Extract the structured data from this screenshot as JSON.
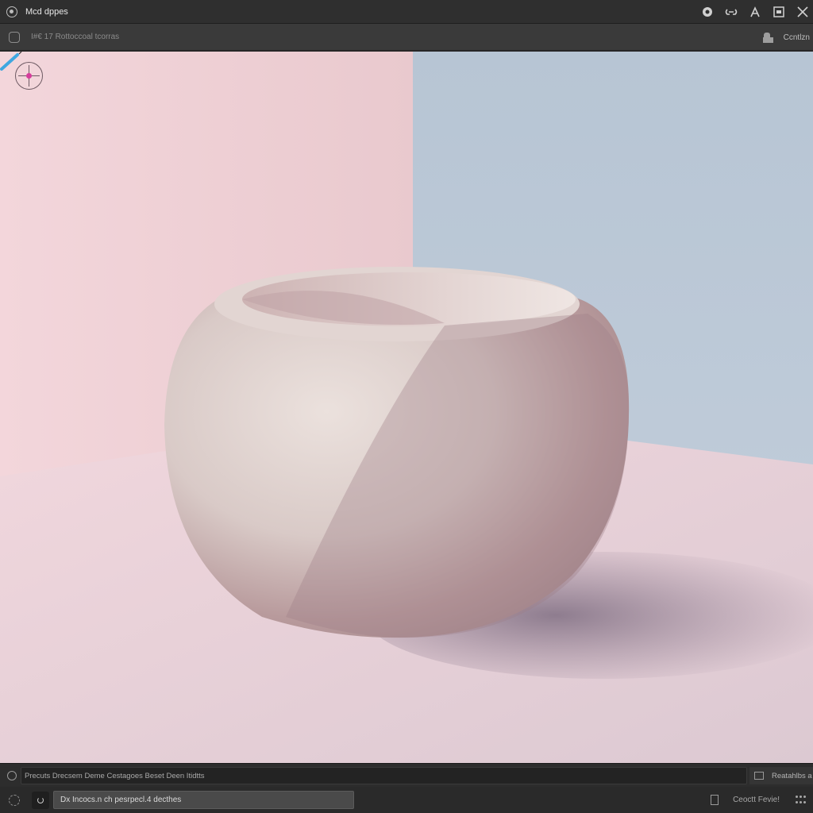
{
  "window": {
    "title": "Mcd dppes",
    "controls": [
      "record-icon",
      "link-icon",
      "pen-icon",
      "maximize-icon",
      "close-icon"
    ]
  },
  "toolbar": {
    "left_label": "I#€ 17 Rottoccoal tcorras",
    "right_label": "Ccntlzn"
  },
  "viewport": {
    "colors": {
      "wall_left": "#edc9cf",
      "wall_right": "#bcc8d6",
      "floor": "#eed6dc",
      "bowl": "#d6c3c0",
      "shadow": "#8f7c8f",
      "gizmo_accent": "#d63c9c"
    }
  },
  "statusbar": {
    "text": "Precuts   Drecsem   Deme   Cestagoes Beset   Deen   Itidtts",
    "right_label": "Reatahlbs a"
  },
  "bottombar": {
    "input_text": "Dx Incocs.n ch pesrpecl.4 decthes",
    "right_label": "Ceoctt Fevie!"
  }
}
